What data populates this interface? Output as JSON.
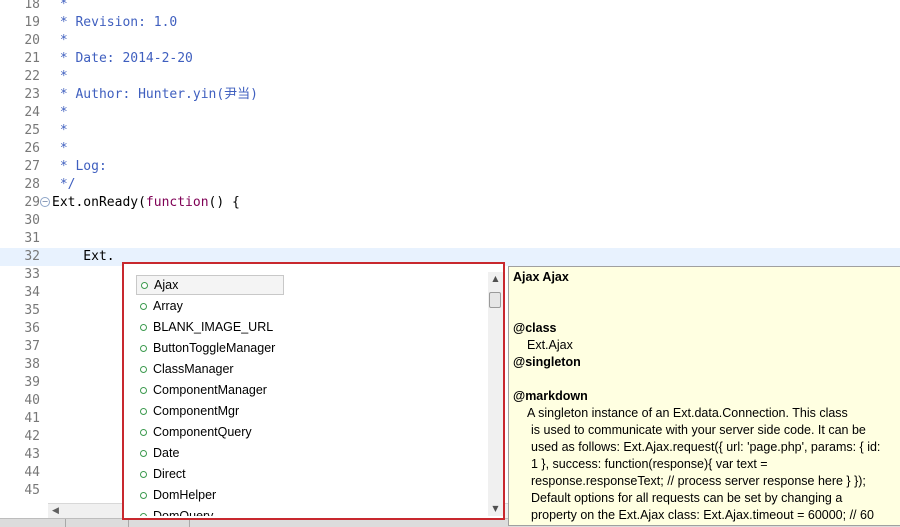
{
  "editor": {
    "lines": [
      {
        "num": "18",
        "text": " *"
      },
      {
        "num": "19",
        "text": " * Revision: 1.0"
      },
      {
        "num": "20",
        "text": " *"
      },
      {
        "num": "21",
        "text": " * Date: 2014-2-20"
      },
      {
        "num": "22",
        "text": " *"
      },
      {
        "num": "23",
        "text": " * Author: Hunter.yin(尹当)"
      },
      {
        "num": "24",
        "text": " *"
      },
      {
        "num": "25",
        "text": " *"
      },
      {
        "num": "26",
        "text": " *"
      },
      {
        "num": "27",
        "text": " * Log:"
      },
      {
        "num": "28",
        "text": " */"
      },
      {
        "num": "29",
        "text_pre": "Ext.onReady(",
        "keyword": "function",
        "text_post": "() {"
      },
      {
        "num": "30",
        "text": ""
      },
      {
        "num": "31",
        "text": ""
      },
      {
        "num": "32",
        "text": "    Ext."
      },
      {
        "num": "33",
        "text": ""
      },
      {
        "num": "34",
        "text": ""
      },
      {
        "num": "35",
        "text": ""
      },
      {
        "num": "36",
        "text": ""
      },
      {
        "num": "37",
        "text": ""
      },
      {
        "num": "38",
        "text": ""
      },
      {
        "num": "39",
        "text": ""
      },
      {
        "num": "40",
        "text": ""
      },
      {
        "num": "41",
        "text": ""
      },
      {
        "num": "42",
        "text": ""
      },
      {
        "num": "43",
        "text": ""
      },
      {
        "num": "44",
        "text": ""
      },
      {
        "num": "45",
        "text": ""
      }
    ],
    "fold_marker": "⊖"
  },
  "completion": {
    "items": [
      "Ajax",
      "Array",
      "BLANK_IMAGE_URL",
      "ButtonToggleManager",
      "ClassManager",
      "ComponentManager",
      "ComponentMgr",
      "ComponentQuery",
      "Date",
      "Direct",
      "DomHelper",
      "DomQuery"
    ],
    "selected_index": 0
  },
  "doc": {
    "title": "Ajax Ajax",
    "class_tag": "@class",
    "class_value": "Ext.Ajax",
    "singleton_tag": "@singleton",
    "markdown_tag": "@markdown",
    "body_lines": [
      "A singleton instance of an Ext.data.Connection. This class",
      "is used to communicate with your server side code. It can be",
      "used as follows: Ext.Ajax.request({ url: 'page.php', params: { id:",
      "1 }, success: function(response){ var text =",
      "response.responseText; // process server response here } });",
      "Default options for all requests can be set by changing a",
      "property on the Ext.Ajax class: Ext.Ajax.timeout = 60000; // 60"
    ]
  },
  "colors": {
    "comment": "#3f5fbf",
    "keyword": "#7f0055",
    "popup_border": "#c8282e",
    "doc_bg": "#ffffe1",
    "current_line": "#e8f2fe"
  },
  "icons": {
    "completion_item": "field-circle-icon",
    "scroll_up": "arrow-up-icon",
    "scroll_down": "arrow-down-icon",
    "scroll_left": "arrow-left-icon"
  }
}
